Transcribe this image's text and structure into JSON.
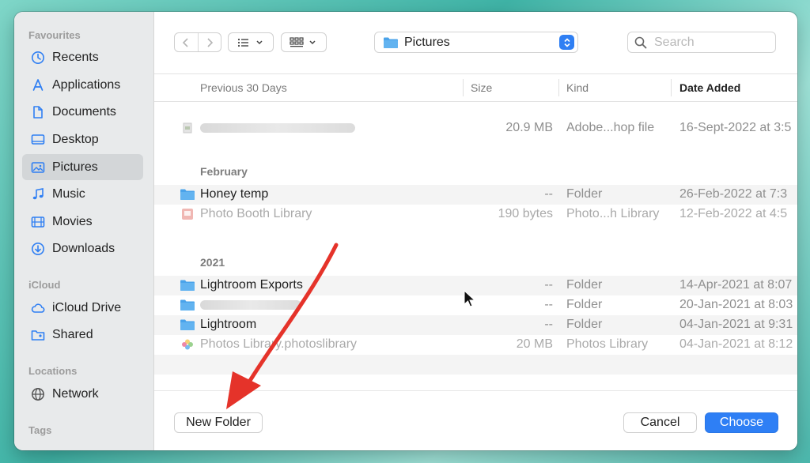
{
  "sidebar": {
    "sections": {
      "favourites": "Favourites",
      "icloud": "iCloud",
      "locations": "Locations",
      "tags": "Tags"
    },
    "items": [
      {
        "label": "Recents",
        "icon": "clock-icon"
      },
      {
        "label": "Applications",
        "icon": "applications-icon"
      },
      {
        "label": "Documents",
        "icon": "document-icon"
      },
      {
        "label": "Desktop",
        "icon": "desktop-icon"
      },
      {
        "label": "Pictures",
        "icon": "photo-icon",
        "selected": true
      },
      {
        "label": "Music",
        "icon": "music-note-icon"
      },
      {
        "label": "Movies",
        "icon": "film-icon"
      },
      {
        "label": "Downloads",
        "icon": "download-icon"
      }
    ],
    "icloud_items": [
      {
        "label": "iCloud Drive",
        "icon": "cloud-icon"
      },
      {
        "label": "Shared",
        "icon": "shared-folder-icon"
      }
    ],
    "location_items": [
      {
        "label": "Network",
        "icon": "globe-icon"
      }
    ]
  },
  "toolbar": {
    "location": "Pictures",
    "search_placeholder": "Search"
  },
  "table": {
    "headers": {
      "name": "Previous 30 Days",
      "size": "Size",
      "kind": "Kind",
      "date": "Date Added"
    },
    "groups": {
      "feb": "February",
      "y2021": "2021"
    },
    "rows": [
      {
        "name": "",
        "size": "20.9 MB",
        "kind": "Adobe...hop file",
        "date": "16-Sept-2022 at 3:5"
      },
      {
        "name": "Honey temp",
        "size": "--",
        "kind": "Folder",
        "date": "26-Feb-2022 at 7:3"
      },
      {
        "name": "Photo Booth Library",
        "size": "190 bytes",
        "kind": "Photo...h Library",
        "date": "12-Feb-2022 at 4:5"
      },
      {
        "name": "Lightroom Exports",
        "size": "--",
        "kind": "Folder",
        "date": "14-Apr-2021 at 8:07"
      },
      {
        "name": "",
        "size": "--",
        "kind": "Folder",
        "date": "20-Jan-2021 at 8:03"
      },
      {
        "name": "Lightroom",
        "size": "--",
        "kind": "Folder",
        "date": "04-Jan-2021 at 9:31"
      },
      {
        "name": "Photos Library.photoslibrary",
        "size": "20 MB",
        "kind": "Photos Library",
        "date": "04-Jan-2021 at 8:12"
      }
    ]
  },
  "footer": {
    "new_folder": "New Folder",
    "cancel": "Cancel",
    "choose": "Choose"
  },
  "colors": {
    "accent": "#2e7ff5",
    "folder": "#4aa3ea",
    "arrow": "#e5332a"
  }
}
